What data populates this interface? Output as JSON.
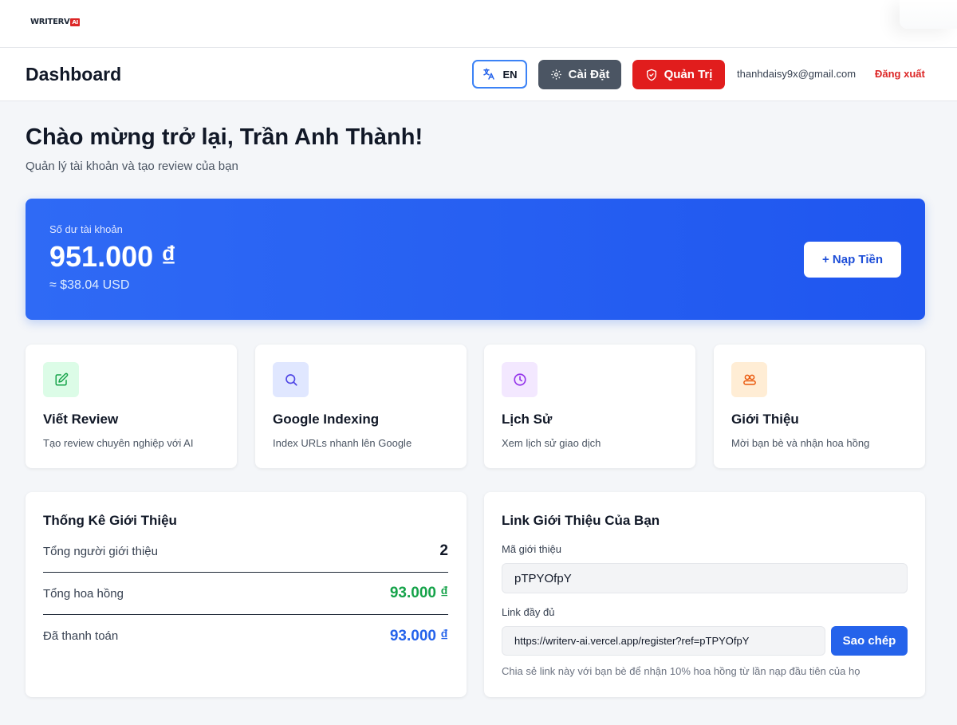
{
  "brand": {
    "logo_text": "WRITERV",
    "logo_badge": "AI"
  },
  "header": {
    "title": "Dashboard",
    "lang_label": "EN",
    "settings_label": "Cài Đặt",
    "admin_label": "Quản Trị",
    "user_email": "thanhdaisy9x@gmail.com",
    "logout_label": "Đăng xuất"
  },
  "welcome": {
    "title": "Chào mừng trở lại, Trần Anh Thành!",
    "subtitle": "Quản lý tài khoản và tạo review của bạn"
  },
  "balance": {
    "label": "Số dư tài khoản",
    "value": "951.000 ₫",
    "usd": "≈ $38.04 USD",
    "topup_label": "+ Nạp Tiền"
  },
  "features": [
    {
      "title": "Viết Review",
      "desc": "Tạo review chuyên nghiệp với AI",
      "icon": "edit-icon",
      "color": "#16a34a",
      "bg": "#dcfce7"
    },
    {
      "title": "Google Indexing",
      "desc": "Index URLs nhanh lên Google",
      "icon": "search-icon",
      "color": "#4f46e5",
      "bg": "#e0e7ff"
    },
    {
      "title": "Lịch Sử",
      "desc": "Xem lịch sử giao dịch",
      "icon": "clock-icon",
      "color": "#9333ea",
      "bg": "#f3e8ff"
    },
    {
      "title": "Giới Thiệu",
      "desc": "Mời bạn bè và nhận hoa hồng",
      "icon": "users-icon",
      "color": "#ea580c",
      "bg": "#ffedd5"
    }
  ],
  "referral_stats": {
    "title": "Thống Kê Giới Thiệu",
    "rows": [
      {
        "label": "Tổng người giới thiệu",
        "value": "2",
        "color": "#111827"
      },
      {
        "label": "Tổng hoa hồng",
        "value": "93.000 ₫",
        "color": "#16a34a"
      },
      {
        "label": "Đã thanh toán",
        "value": "93.000 ₫",
        "color": "#2563eb"
      }
    ]
  },
  "referral_link": {
    "title": "Link Giới Thiệu Của Bạn",
    "code_label": "Mã giới thiệu",
    "code_value": "pTPYOfpY",
    "link_label": "Link đầy đủ",
    "link_value": "https://writerv-ai.vercel.app/register?ref=pTPYOfpY",
    "copy_label": "Sao chép",
    "hint": "Chia sẻ link này với bạn bè để nhận 10% hoa hồng từ lần nạp đầu tiên của họ"
  }
}
